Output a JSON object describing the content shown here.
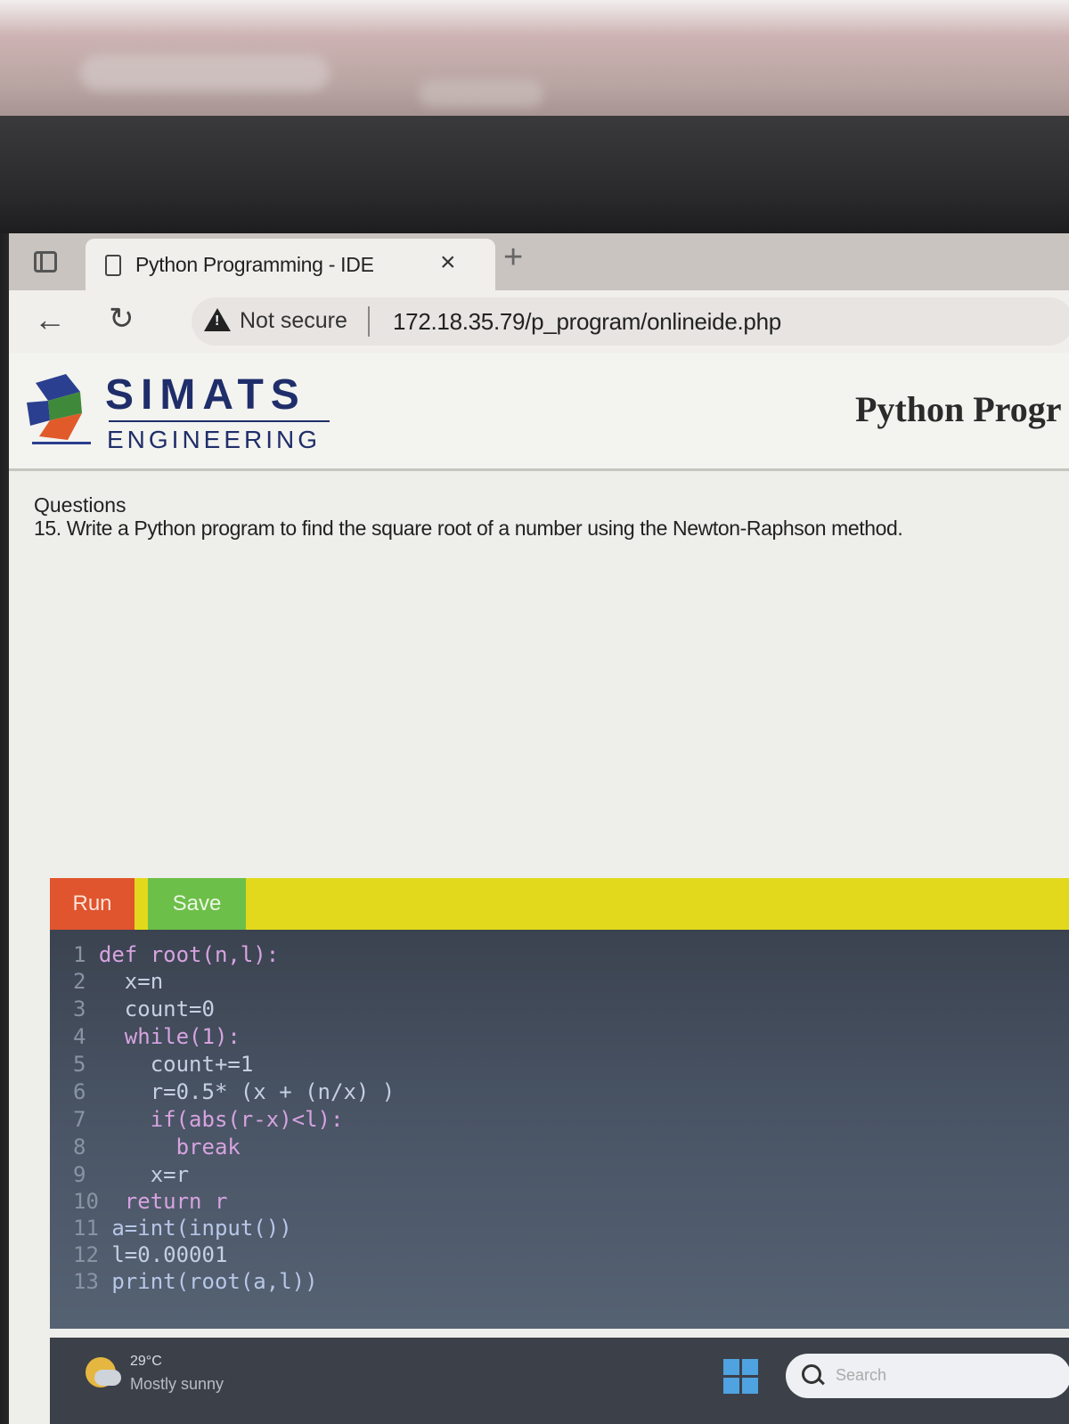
{
  "browser": {
    "tab_title": "Python Programming - IDE",
    "tab_close": "×",
    "new_tab": "+",
    "security_label": "Not secure",
    "url": "172.18.35.79/p_program/onlineide.php"
  },
  "header": {
    "brand_top": "SIMATS",
    "brand_bottom": "ENGINEERING",
    "course_title": "Python Progr"
  },
  "question": {
    "heading": "Questions",
    "text": "15. Write a Python program to find the square root of a number using the Newton-Raphson method."
  },
  "toolbar": {
    "run_label": "Run",
    "save_label": "Save"
  },
  "editor": {
    "lines": [
      {
        "num": "1",
        "code": "def root(n,l):"
      },
      {
        "num": "2",
        "code": "  x=n"
      },
      {
        "num": "3",
        "code": "  count=0"
      },
      {
        "num": "4",
        "code": "  while(1):"
      },
      {
        "num": "5",
        "code": "    count+=1"
      },
      {
        "num": "6",
        "code": "    r=0.5* (x + (n/x) )"
      },
      {
        "num": "7",
        "code": "    if(abs(r-x)<l):"
      },
      {
        "num": "8",
        "code": "      break"
      },
      {
        "num": "9",
        "code": "    x=r"
      },
      {
        "num": "10",
        "code": " return r"
      },
      {
        "num": "11",
        "code": "a=int(input())"
      },
      {
        "num": "12",
        "code": "l=0.00001"
      },
      {
        "num": "13",
        "code": "print(root(a,l))"
      }
    ]
  },
  "taskbar": {
    "temperature": "29°C",
    "condition": "Mostly sunny",
    "search_placeholder": "Search"
  },
  "colors": {
    "run": "#e0542e",
    "save": "#6cbf49",
    "bar": "#e2d91c",
    "brand": "#1f2e6a"
  }
}
